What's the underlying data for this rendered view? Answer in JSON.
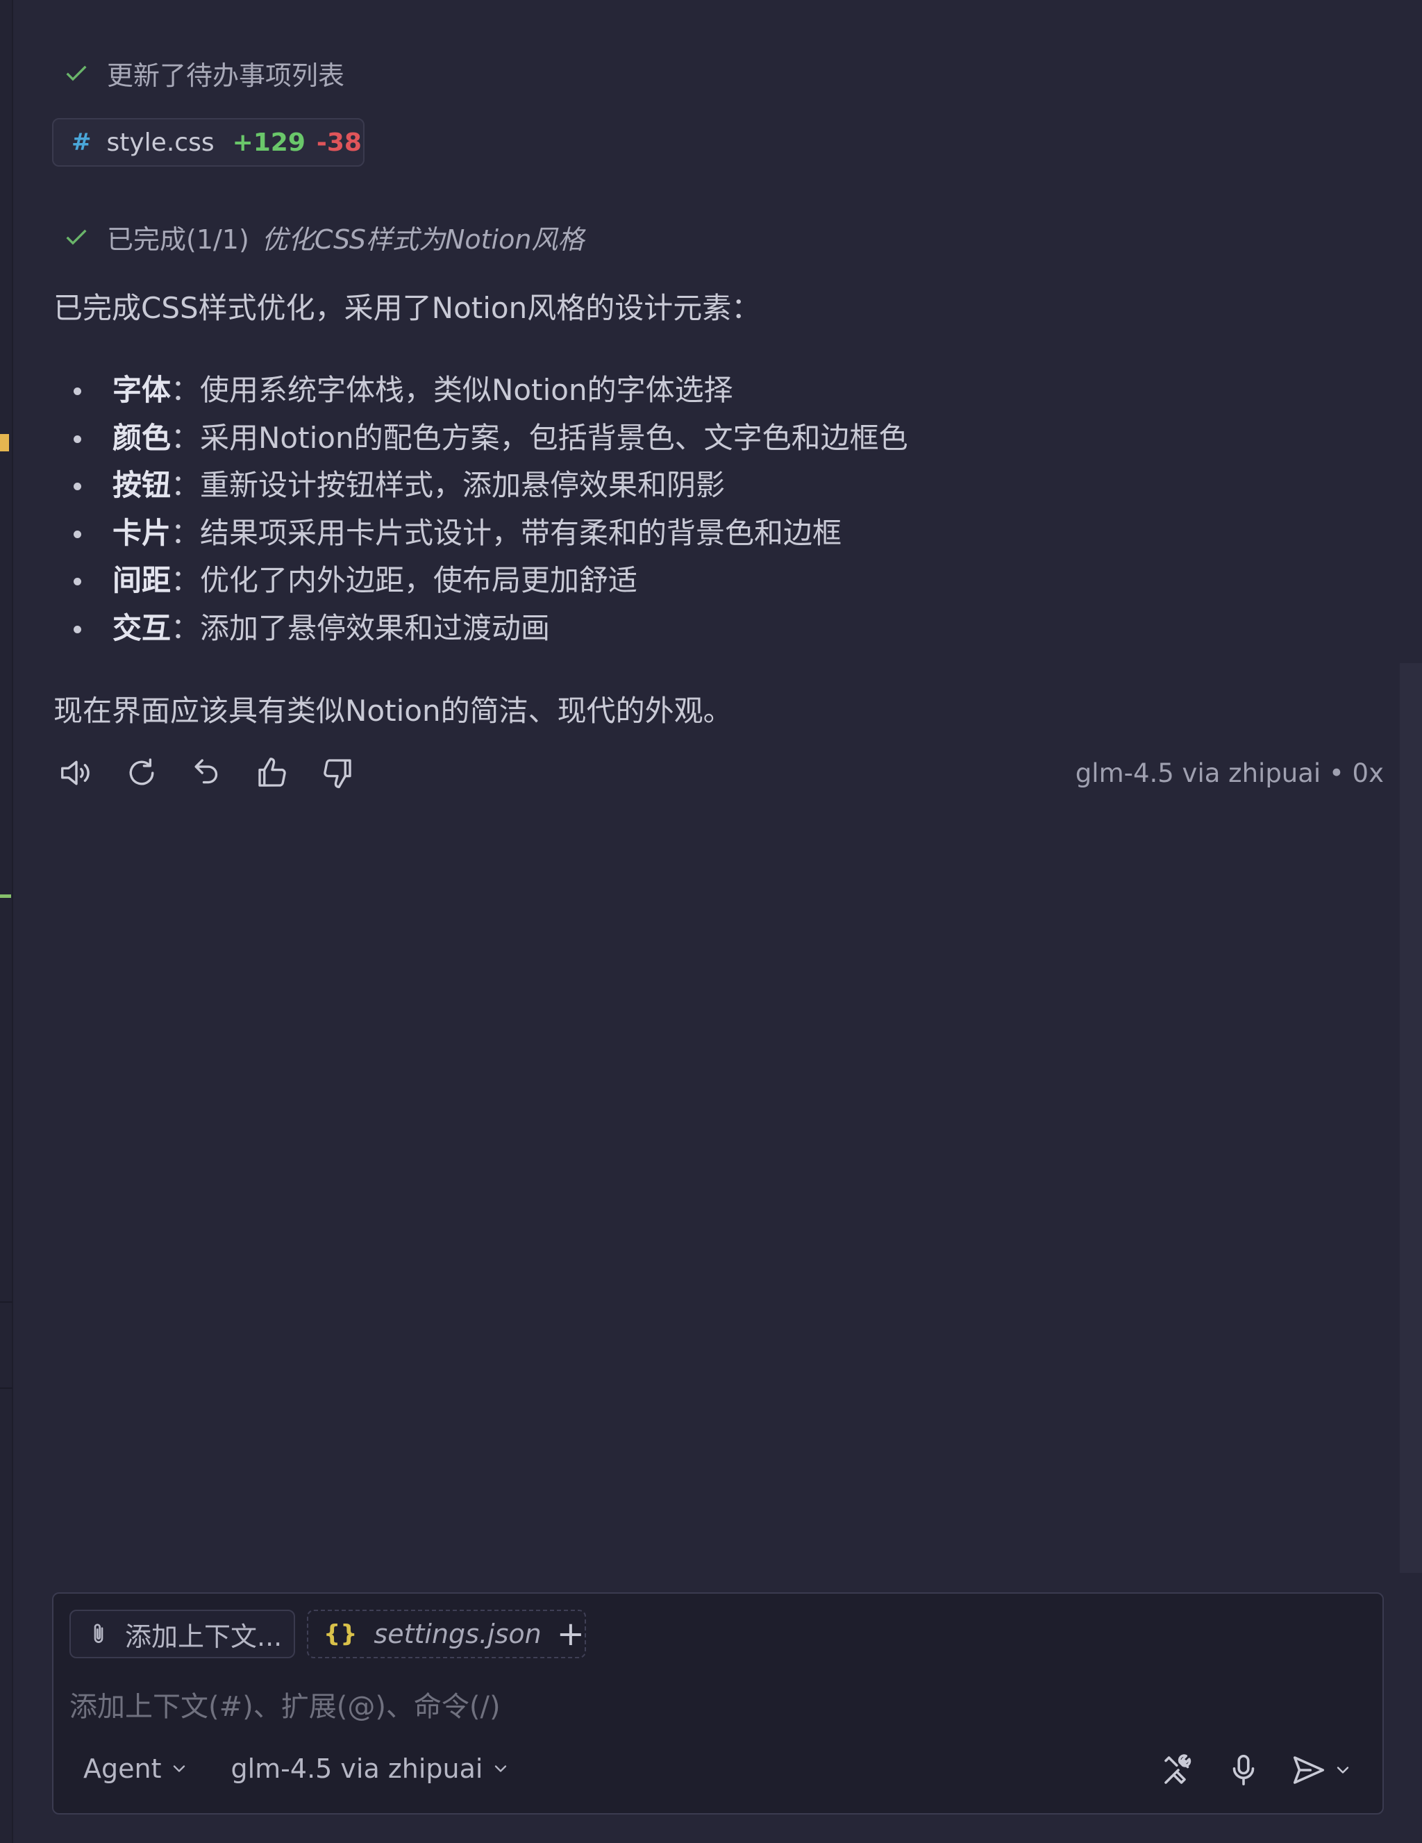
{
  "steps": {
    "todo_updated": "更新了待办事项列表",
    "completed_prefix": "已完成(1/1)",
    "completed_task": "优化CSS样式为Notion风格"
  },
  "file_change": {
    "hash": "#",
    "filename": "style.css",
    "added": "+129",
    "removed": "-38"
  },
  "message": {
    "intro": "已完成CSS样式优化，采用了Notion风格的设计元素：",
    "bullets": [
      {
        "term": "字体",
        "text": "：使用系统字体栈，类似Notion的字体选择"
      },
      {
        "term": "颜色",
        "text": "：采用Notion的配色方案，包括背景色、文字色和边框色"
      },
      {
        "term": "按钮",
        "text": "：重新设计按钮样式，添加悬停效果和阴影"
      },
      {
        "term": "卡片",
        "text": "：结果项采用卡片式设计，带有柔和的背景色和边框"
      },
      {
        "term": "间距",
        "text": "：优化了内外边距，使布局更加舒适"
      },
      {
        "term": "交互",
        "text": "：添加了悬停效果和过渡动画"
      }
    ],
    "conclusion": "现在界面应该具有类似Notion的简洁、现代的外观。"
  },
  "actions": {
    "icons": [
      "speaker-icon",
      "retry-icon",
      "undo-icon",
      "thumbs-up-icon",
      "thumbs-down-icon"
    ],
    "model_info": "glm-4.5 via zhipuai • 0x"
  },
  "composer": {
    "add_context_label": "添加上下文...",
    "settings_chip_label": "settings.json",
    "settings_chip_brace": "{}",
    "add_chip": "+",
    "placeholder": "添加上下文(#)、扩展(@)、命令(/)",
    "mode": "Agent",
    "model": "glm-4.5 via zhipuai"
  },
  "colors": {
    "background": "#262637",
    "added": "#6ac76a",
    "removed": "#e0555a",
    "check": "#6ab56a"
  }
}
